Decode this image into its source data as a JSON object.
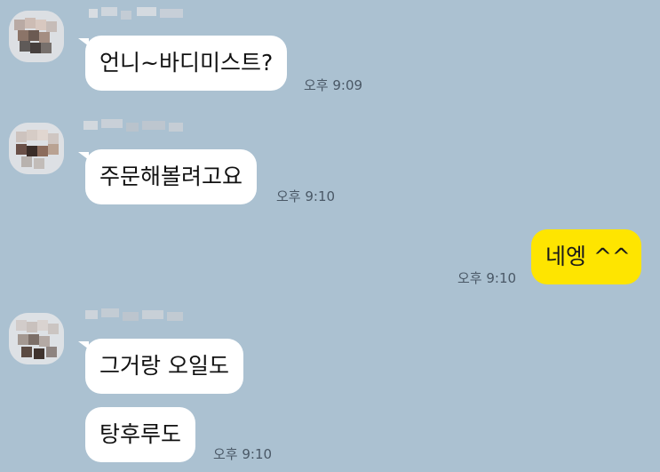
{
  "theme": {
    "background": "#abc1d1",
    "incoming_bubble": "#ffffff",
    "outgoing_bubble": "#fee500"
  },
  "messages": [
    {
      "direction": "incoming",
      "text": "언니~바디미스트?",
      "time": "오후 9:09"
    },
    {
      "direction": "incoming",
      "text": "주문해볼려고요",
      "time": "오후 9:10"
    },
    {
      "direction": "outgoing",
      "text": "네엥 ^^",
      "time": "오후 9:10"
    },
    {
      "direction": "incoming",
      "text": "그거랑 오일도"
    },
    {
      "direction": "incoming",
      "text": "탕후루도",
      "time": "오후 9:10"
    }
  ]
}
